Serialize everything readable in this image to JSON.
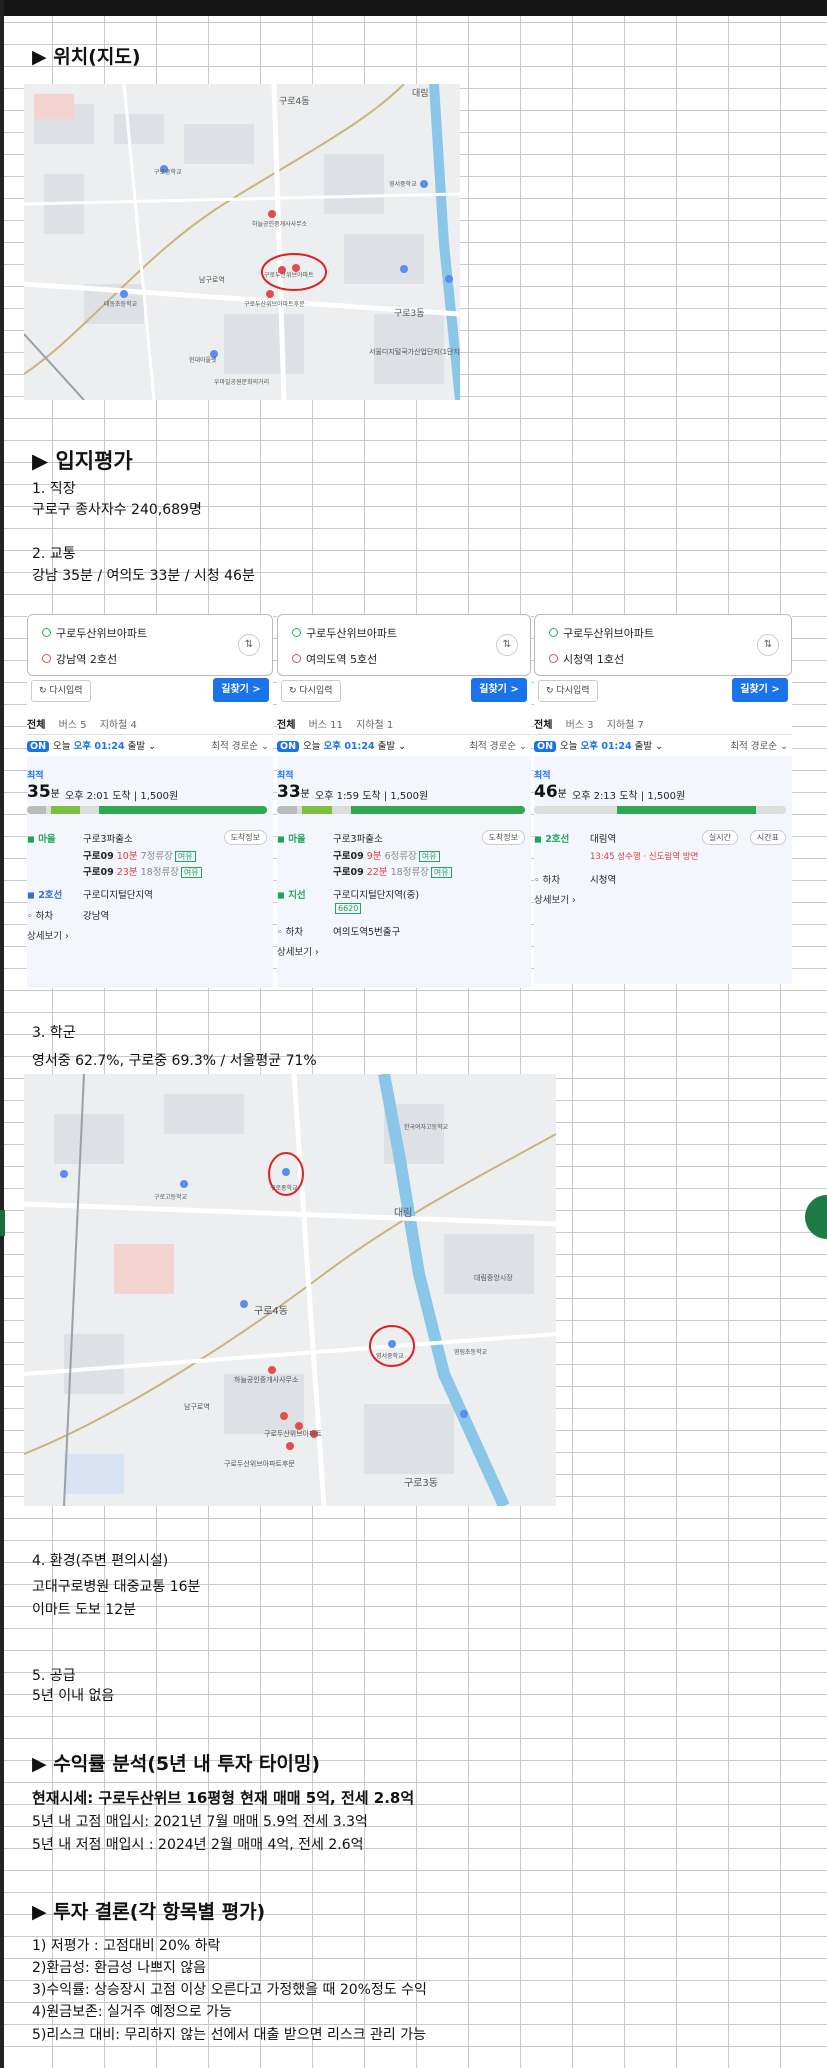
{
  "sections": {
    "location_title": "▶ 위치(지도)",
    "evaluation_title": "▶ 입지평가",
    "return_title": "▶ 수익률 분석(5년 내 투자 타이밍)",
    "conclusion_title": "▶ 투자 결론(각 항목별 평가)"
  },
  "evaluation": {
    "job_title": "1. 직장",
    "job_text": "구로구 종사자수 240,689명",
    "transport_title": "2. 교통",
    "transport_text": "강남 35분 / 여의도 33분 / 시청 46분",
    "school_title": "3. 학군",
    "school_text": "영서중 62.7%,  구로중 69.3%    / 서울평균 71%",
    "env_title": "4. 환경(주변 편의시설)",
    "env_line1": "고대구로병원 대중교통 16분",
    "env_line2": "이마트 도보 12분",
    "supply_title": "5. 공급",
    "supply_text": "5년 이내 없음"
  },
  "returns": {
    "current": "현재시세: 구로두산위브 16평형 현재 매매 5억, 전세 2.8억",
    "high": "5년 내 고점 매입시: 2021년 7월 매매 5.9억 전세 3.3억",
    "low": "5년 내 저점 매입시 : 2024년 2월 매매 4억, 전세 2.6억"
  },
  "conclusion": [
    "1) 저평가 : 고점대비 20%  하락",
    "2)환금성: 환금성 나쁘지 않음",
    "3)수익률: 상승장시 고점 이상 오른다고 가정했을 때 20%정도 수익",
    "4)원금보존: 실거주 예정으로 가능",
    "5)리스크 대비: 무리하지 않는 선에서 대출 받으면 리스크 관리 가능"
  ],
  "map1": {
    "labels": [
      "구로4동",
      "대림",
      "구로3동",
      "하늘공인중개사사무소",
      "구로두산위브아파트",
      "구로두산위브아파트후문",
      "남구로역",
      "서울디지털국가산업단지(1단지)",
      "우마일공원문화의거리",
      "현대아울렛",
      "영서중학교",
      "구로중학교",
      "대동초등학교"
    ]
  },
  "map2": {
    "labels": [
      "구로4동",
      "구로중학교",
      "영서중학교",
      "구로3동",
      "대림",
      "대림중앙시장",
      "하늘공인중개사사무소",
      "구로두산위브아파트",
      "구로두산위브아파트후문",
      "남구로역",
      "구로중학교",
      "한국여자고등학교",
      "영림초등학교",
      "구로고등학교"
    ]
  },
  "routes": [
    {
      "origin": "구로두산위브아파트",
      "dest": "강남역 2호선",
      "reset": "다시입력",
      "go": "길찾기 >",
      "tabs": [
        "전체",
        "버스 5",
        "지하철 4"
      ],
      "on": "ON",
      "today": "오늘",
      "dep_time": "오후 01:24",
      "dep_suffix": "출발 ⌄",
      "sort": "최적 경로순 ⌄",
      "best": "최적",
      "min": "35",
      "min_unit": "분",
      "arrive": "오후 2:01 도착  |  1,500원",
      "seg_walk": "2분",
      "seg_bus": "4분",
      "seg_sub": "22분",
      "board_label": "◼ 마을",
      "board_stop": "구로3파출소",
      "detail_btn": "도착정보",
      "bus1": "구로09",
      "bus1_time": "10분",
      "bus1_info": "7정류장",
      "bus2": "구로09",
      "bus2_time": "23분",
      "bus2_info": "18정류장",
      "seat": "여유",
      "transfer_label": "◼ 2호선",
      "transfer_stop": "구로디지털단지역",
      "alight_label": "◦ 하차",
      "alight_stop": "강남역",
      "more": "상세보기 ›"
    },
    {
      "origin": "구로두산위브아파트",
      "dest": "여의도역 5호선",
      "reset": "다시입력",
      "go": "길찾기 >",
      "tabs": [
        "전체",
        "버스 11",
        "지하철 1"
      ],
      "on": "ON",
      "today": "오늘",
      "dep_time": "오후 01:24",
      "dep_suffix": "출발 ⌄",
      "sort": "최적 경로순 ⌄",
      "best": "최적",
      "min": "33",
      "min_unit": "분",
      "arrive": "오후 1:59 도착  |  1,500원",
      "seg_walk": "2분",
      "seg_bus": "4분",
      "seg_sub": "19분",
      "board_label": "◼ 마을",
      "board_stop": "구로3파출소",
      "detail_btn": "도착정보",
      "bus1": "구로09",
      "bus1_time": "9분",
      "bus1_info": "6정류장",
      "bus2": "구로09",
      "bus2_time": "22분",
      "bus2_info": "18정류장",
      "seat": "여유",
      "transfer_label": "◼ 지선",
      "transfer_stop": "구로디지털단지역(중)",
      "transfer_bus": "6620",
      "alight_label": "◦ 하차",
      "alight_stop": "여의도역5번출구",
      "more": "상세보기 ›"
    },
    {
      "origin": "구로두산위브아파트",
      "dest": "시청역 1호선",
      "reset": "다시입력",
      "go": "길찾기 >",
      "tabs": [
        "전체",
        "버스 3",
        "지하철 7"
      ],
      "on": "ON",
      "today": "오늘",
      "dep_time": "오후 01:24",
      "dep_suffix": "출발 ⌄",
      "sort": "최적 경로순 ⌄",
      "best": "최적",
      "min": "46",
      "min_unit": "분",
      "arrive": "오후 2:13 도착  |  1,500원",
      "seg_walk": "16분",
      "seg_sub": "24분",
      "seg_end": "4분",
      "transfer_label": "◼ 2호선",
      "transfer_stop": "대림역",
      "train_info": "13:45 성수행 · 신도림역 방면",
      "btn_live": "실시간",
      "btn_table": "시간표",
      "alight_label": "◦ 하차",
      "alight_stop": "시청역",
      "more": "상세보기 ›"
    }
  ],
  "colors": {
    "accent_blue": "#1a73e8",
    "green": "#25b05a",
    "red_marker": "#e54b4b"
  }
}
